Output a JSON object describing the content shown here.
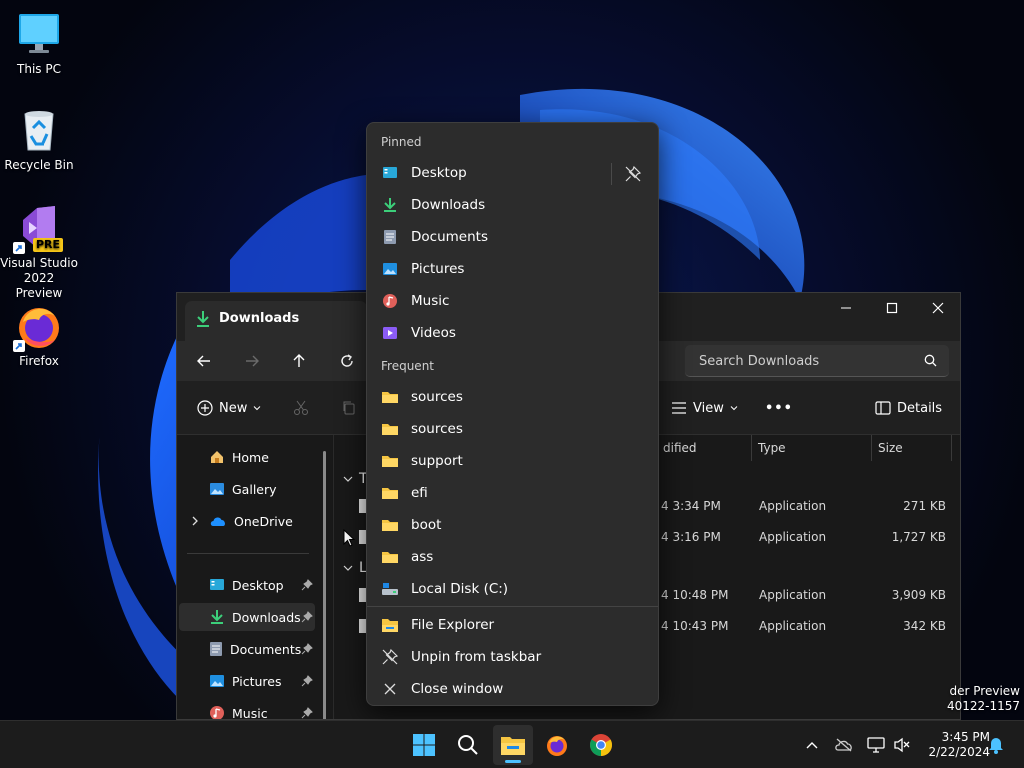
{
  "desktop": {
    "icons": [
      {
        "label": "This PC"
      },
      {
        "label": "Recycle Bin"
      },
      {
        "label": "Visual Studio 2022 Preview",
        "badge": "PRE"
      },
      {
        "label": "Firefox"
      }
    ]
  },
  "explorer": {
    "tab_title": "Downloads",
    "search_placeholder": "Search Downloads",
    "commands": {
      "new": "New",
      "view": "View",
      "more": "•••",
      "details": "Details"
    },
    "sidebar": {
      "items": [
        {
          "label": "Home"
        },
        {
          "label": "Gallery"
        },
        {
          "label": "OneDrive"
        },
        {
          "label": "Desktop"
        },
        {
          "label": "Downloads"
        },
        {
          "label": "Documents"
        },
        {
          "label": "Pictures"
        },
        {
          "label": "Music"
        }
      ]
    },
    "columns": {
      "modified": "dified",
      "type": "Type",
      "size": "Size"
    },
    "group_labels": [
      "T",
      "L"
    ],
    "rows": [
      {
        "modified": "4 3:34 PM",
        "type": "Application",
        "size": "271 KB"
      },
      {
        "modified": "4 3:16 PM",
        "type": "Application",
        "size": "1,727 KB"
      },
      {
        "modified": "4 10:48 PM",
        "type": "Application",
        "size": "3,909 KB"
      },
      {
        "modified": "4 10:43 PM",
        "type": "Application",
        "size": "342 KB"
      }
    ]
  },
  "watermark": {
    "line1": "der Preview",
    "line2": "40122-1157"
  },
  "jumplist": {
    "pinned_header": "Pinned",
    "pinned": [
      {
        "label": "Desktop"
      },
      {
        "label": "Downloads"
      },
      {
        "label": "Documents"
      },
      {
        "label": "Pictures"
      },
      {
        "label": "Music"
      },
      {
        "label": "Videos"
      }
    ],
    "frequent_header": "Frequent",
    "frequent": [
      {
        "label": "sources"
      },
      {
        "label": "sources"
      },
      {
        "label": "support"
      },
      {
        "label": "efi"
      },
      {
        "label": "boot"
      },
      {
        "label": "ass"
      },
      {
        "label": "Local Disk (C:)"
      }
    ],
    "actions": [
      {
        "label": "File Explorer"
      },
      {
        "label": "Unpin from taskbar"
      },
      {
        "label": "Close window"
      }
    ]
  },
  "taskbar": {
    "clock_time": "3:45 PM",
    "clock_date": "2/22/2024",
    "accent_color": "#4cc2ff"
  }
}
